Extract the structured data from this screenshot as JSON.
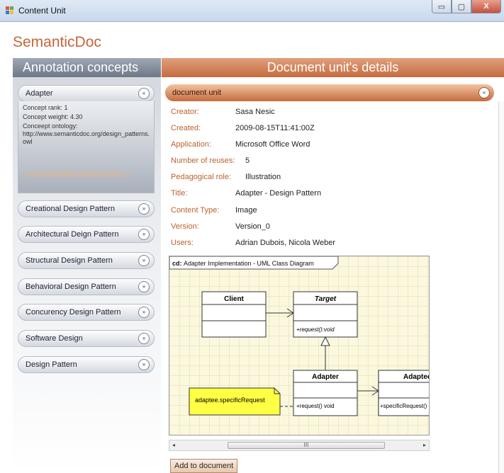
{
  "window": {
    "title": "Content Unit",
    "buttons": {
      "minimize": "▭",
      "maximize": "▢",
      "close": "X"
    }
  },
  "brand": "SemanticDoc",
  "left_panel": {
    "header": "Annotation concepts",
    "adapter": {
      "label": "Adapter",
      "chevron": "«",
      "rank": "Concept rank: 1",
      "weight": "Concept weight: 4.30",
      "ontology_label": "Conceept ontology:",
      "ontology_value": "http://www.semanticdoc.org/design_patterns.owl",
      "browse_link": "browse annotated document units >>"
    },
    "concepts": [
      {
        "label": "Creational Design Pattern",
        "chevron": "»"
      },
      {
        "label": "Architectural Deign Pattern",
        "chevron": "»"
      },
      {
        "label": "Structural Design Pattern",
        "chevron": "»"
      },
      {
        "label": "Behavioral Design Pattern",
        "chevron": "»"
      },
      {
        "label": "Concurency Design Pattern",
        "chevron": "»"
      },
      {
        "label": "Software Design",
        "chevron": "»"
      },
      {
        "label": "Design Pattern",
        "chevron": "»"
      }
    ]
  },
  "right_panel": {
    "header": "Document unit's details",
    "section_title": "document unit",
    "section_chevron": "«",
    "fields": [
      {
        "label": "Creator:",
        "value": "Sasa Nesic"
      },
      {
        "label": "Created:",
        "value": "2009-08-15T11:41:00Z"
      },
      {
        "label": "Application:",
        "value": "Microsoft Office Word"
      },
      {
        "label": "Number of reuses:",
        "value": "5"
      },
      {
        "label": "Pedagogical role:",
        "value": "Illustration"
      },
      {
        "label": "Title:",
        "value": "Adapter - Design Pattern"
      },
      {
        "label": "Content Type:",
        "value": "Image"
      },
      {
        "label": "Version:",
        "value": "Version_0"
      },
      {
        "label": "Users:",
        "value": "Adrian Dubois, Nicola Weber"
      }
    ],
    "diagram": {
      "frame_prefix": "cd:",
      "frame_title": "Adapter Implementation - UML Class Diagram",
      "client": "Client",
      "target": "Target",
      "target_op": "+request():void",
      "adapter": "Adapter",
      "adapter_op": "+request() void",
      "adaptee": "Adaptee",
      "adaptee_op": "+specificRequest()",
      "note": "adaptee.specificRequest"
    },
    "scrollbar": {
      "left": "◂",
      "right": "▸",
      "grip": "III"
    },
    "add_button": "Add to document"
  },
  "colors": {
    "accent_orange": "#c66b3f",
    "brand_text": "#c7653a",
    "label_text": "#b9622e",
    "left_header": "#7b8493",
    "note_yellow": "#ffff44"
  }
}
